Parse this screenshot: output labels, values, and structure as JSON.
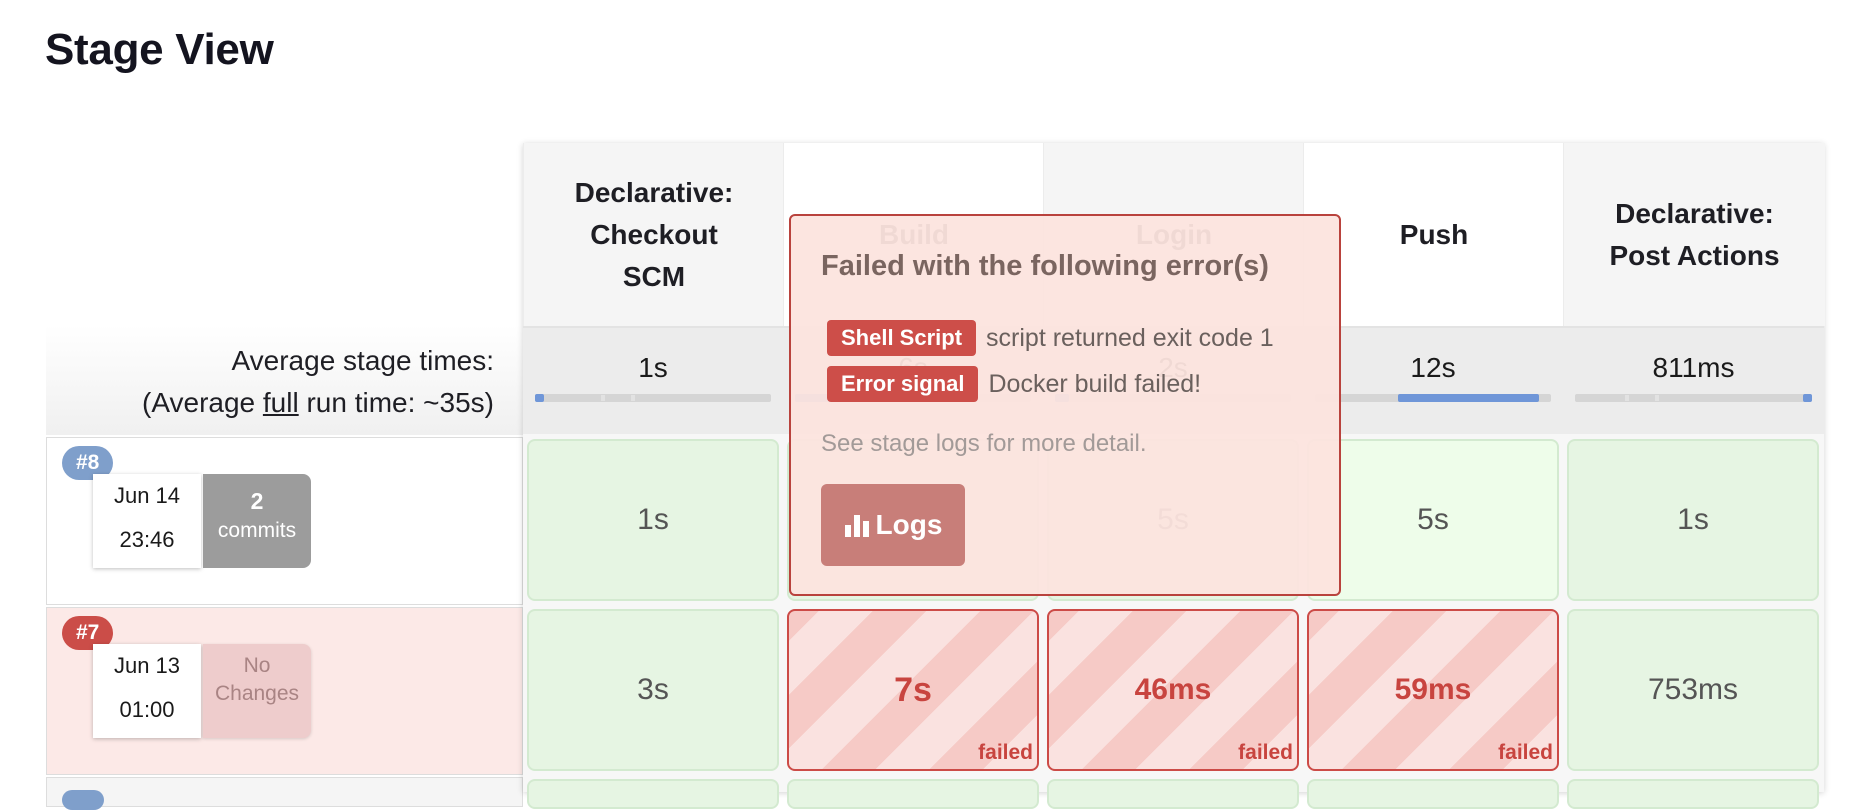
{
  "page": {
    "title": "Stage View"
  },
  "summary": {
    "avg_line1": "Average stage times:",
    "avg_prefix": "(Average ",
    "avg_full": "full",
    "avg_suffix": " run time: ~35s)"
  },
  "stages": [
    {
      "name": "Declarative:\nCheckout\nSCM",
      "avg": "1s",
      "avg_fraction": 0.04
    },
    {
      "name": "Build",
      "avg": "6s",
      "avg_fraction": 0.17
    },
    {
      "name": "Login",
      "avg": "2s",
      "avg_fraction": 0.06
    },
    {
      "name": "Push",
      "avg": "12s",
      "avg_fraction": 0.34
    },
    {
      "name": "Declarative:\nPost Actions",
      "avg": "811ms",
      "avg_fraction": 0.02
    }
  ],
  "runs": [
    {
      "number": "#8",
      "date": "Jun 14",
      "time": "23:46",
      "changes_count": "2",
      "changes_label": "commits",
      "status": "success",
      "cells": [
        {
          "duration": "1s",
          "status": "success"
        },
        {
          "duration": "2s",
          "status": "success"
        },
        {
          "duration": "5s",
          "status": "success"
        },
        {
          "duration": "5s",
          "status": "success"
        },
        {
          "duration": "1s",
          "status": "success"
        }
      ]
    },
    {
      "number": "#7",
      "date": "Jun 13",
      "time": "01:00",
      "changes_label": "No\nChanges",
      "status": "failed",
      "cells": [
        {
          "duration": "3s",
          "status": "success"
        },
        {
          "duration": "7s",
          "status": "failed",
          "label": "failed"
        },
        {
          "duration": "46ms",
          "status": "failed",
          "label": "failed"
        },
        {
          "duration": "59ms",
          "status": "failed",
          "label": "failed"
        },
        {
          "duration": "753ms",
          "status": "success"
        }
      ]
    }
  ],
  "popover": {
    "title": "Failed with the following error(s)",
    "errors": [
      {
        "type": "Shell Script",
        "message": "script returned exit code 1"
      },
      {
        "type": "Error signal",
        "message": "Docker build failed!"
      }
    ],
    "hint": "See stage logs for more detail.",
    "logs_button": "Logs",
    "logs_icon": "bar-chart-icon"
  },
  "colors": {
    "success_bg": "#e6f5e3",
    "failed_bg": "#f6cac6",
    "failed_text": "#c8443f",
    "run_badge_success": "#7f9fcb",
    "run_badge_failed": "#cb4d48",
    "progress_fill": "#6f96d8"
  }
}
